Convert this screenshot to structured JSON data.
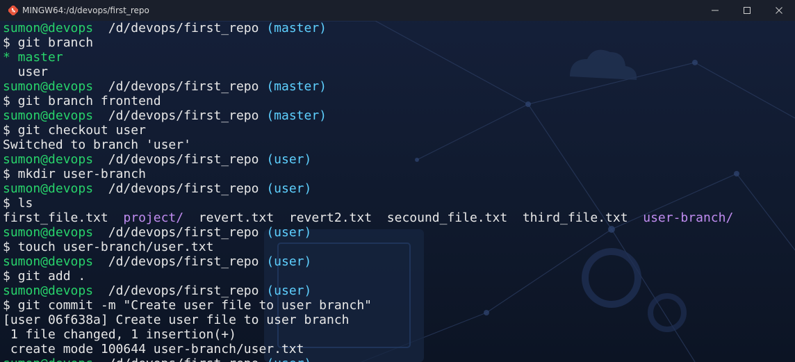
{
  "window": {
    "title": "MINGW64:/d/devops/first_repo",
    "icons": {
      "app": "git-bash-icon",
      "minimize": "minimize-icon",
      "maximize": "maximize-icon",
      "close": "close-icon"
    }
  },
  "colors": {
    "prompt_user": "#28d36b",
    "prompt_branch": "#5ed0ff",
    "directory": "#c08cf0",
    "text": "#e8e8e8"
  },
  "terminal": {
    "lines": [
      {
        "kind": "prompt",
        "user": "sumon@devops",
        "path": "/d/devops/first_repo",
        "branch": "(master)"
      },
      {
        "kind": "output",
        "text": "$ git branch"
      },
      {
        "kind": "current_branch",
        "text": "* master"
      },
      {
        "kind": "output",
        "text": "  user"
      },
      {
        "kind": "prompt",
        "user": "sumon@devops",
        "path": "/d/devops/first_repo",
        "branch": "(master)"
      },
      {
        "kind": "output",
        "text": "$ git branch frontend"
      },
      {
        "kind": "prompt",
        "user": "sumon@devops",
        "path": "/d/devops/first_repo",
        "branch": "(master)"
      },
      {
        "kind": "output",
        "text": "$ git checkout user"
      },
      {
        "kind": "output",
        "text": "Switched to branch 'user'"
      },
      {
        "kind": "prompt",
        "user": "sumon@devops",
        "path": "/d/devops/first_repo",
        "branch": "(user)"
      },
      {
        "kind": "output",
        "text": "$ mkdir user-branch"
      },
      {
        "kind": "prompt",
        "user": "sumon@devops",
        "path": "/d/devops/first_repo",
        "branch": "(user)"
      },
      {
        "kind": "output",
        "text": "$ ls"
      },
      {
        "kind": "ls",
        "items": [
          {
            "text": "first_file.txt",
            "type": "file"
          },
          {
            "text": "project/",
            "type": "dir"
          },
          {
            "text": "revert.txt",
            "type": "file"
          },
          {
            "text": "revert2.txt",
            "type": "file"
          },
          {
            "text": "secound_file.txt",
            "type": "file"
          },
          {
            "text": "third_file.txt",
            "type": "file"
          },
          {
            "text": "user-branch/",
            "type": "dir"
          }
        ]
      },
      {
        "kind": "prompt",
        "user": "sumon@devops",
        "path": "/d/devops/first_repo",
        "branch": "(user)"
      },
      {
        "kind": "output",
        "text": "$ touch user-branch/user.txt"
      },
      {
        "kind": "prompt",
        "user": "sumon@devops",
        "path": "/d/devops/first_repo",
        "branch": "(user)"
      },
      {
        "kind": "output",
        "text": "$ git add ."
      },
      {
        "kind": "prompt",
        "user": "sumon@devops",
        "path": "/d/devops/first_repo",
        "branch": "(user)"
      },
      {
        "kind": "output",
        "text": "$ git commit -m \"Create user file to user branch\""
      },
      {
        "kind": "output",
        "text": "[user 06f638a] Create user file to user branch"
      },
      {
        "kind": "output",
        "text": " 1 file changed, 1 insertion(+)"
      },
      {
        "kind": "output",
        "text": " create mode 100644 user-branch/user.txt"
      },
      {
        "kind": "prompt",
        "user": "sumon@devops",
        "path": "/d/devops/first_repo",
        "branch": "(user)"
      }
    ]
  }
}
